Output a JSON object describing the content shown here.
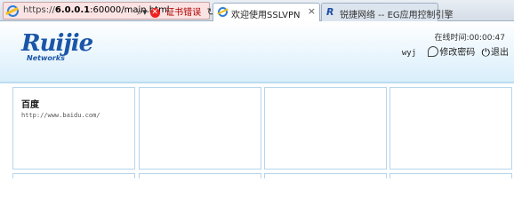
{
  "browser": {
    "url_prefix": "https://",
    "url_host": "6.0.0.1",
    "url_rest": ":60000/main.html",
    "cert_error_label": "证书错误",
    "tabs": [
      {
        "label": "欢迎使用SSLVPN",
        "active": true
      },
      {
        "label": "锐捷网络 -- EG应用控制引擎",
        "active": false
      }
    ]
  },
  "header": {
    "logo_text": "Ruijie",
    "logo_sub": "Networks",
    "online_label": "在线时间:00:00:47",
    "username": "wyj",
    "change_password_label": "修改密码",
    "logout_label": "退出"
  },
  "resources": [
    {
      "title": "百度",
      "url": "http://www.baidu.com/"
    },
    {
      "title": "",
      "url": ""
    },
    {
      "title": "",
      "url": ""
    },
    {
      "title": "",
      "url": ""
    }
  ],
  "colors": {
    "brand": "#1a56a8",
    "card_border": "#b7d5ec",
    "header_gradient_end": "#d9eefb"
  }
}
